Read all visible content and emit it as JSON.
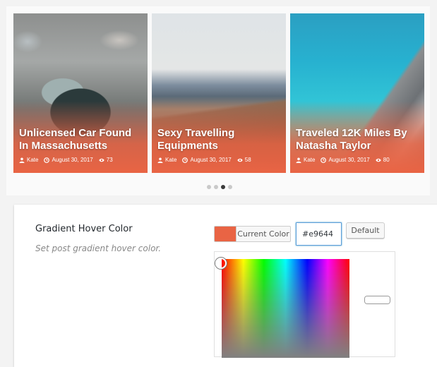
{
  "colors": {
    "accent": "#e9644",
    "hover_gradient": "#e96444"
  },
  "carousel": {
    "cards": [
      {
        "title": "Unlicensed Car Found In Massachusetts",
        "author": "Kate",
        "date": "August 30, 2017",
        "views": "73"
      },
      {
        "title": "Sexy Travelling Equipments",
        "author": "Kate",
        "date": "August 30, 2017",
        "views": "58"
      },
      {
        "title": "Traveled 12K Miles By Natasha Taylor",
        "author": "Kate",
        "date": "August 30, 2017",
        "views": "80"
      }
    ],
    "dots_count": 4,
    "active_dot": 3
  },
  "settings": {
    "label": "Gradient Hover Color",
    "description": "Set post gradient hover color.",
    "current_color_label": "Current Color",
    "hex_value": "#e9644",
    "default_label": "Default"
  }
}
